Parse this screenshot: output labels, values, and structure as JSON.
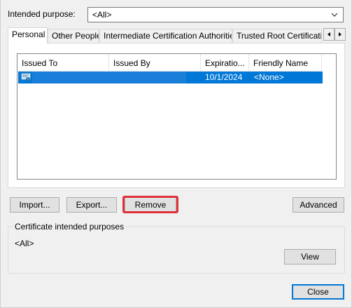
{
  "purpose": {
    "label": "Intended purpose:",
    "selected": "<All>"
  },
  "tabs": [
    {
      "label": "Personal",
      "active": true
    },
    {
      "label": "Other People",
      "active": false
    },
    {
      "label": "Intermediate Certification Authorities",
      "active": false
    },
    {
      "label": "Trusted Root Certification",
      "active": false
    }
  ],
  "list": {
    "columns": [
      "Issued To",
      "Issued By",
      "Expiratio...",
      "Friendly Name"
    ],
    "rows": [
      {
        "issued_to": "",
        "issued_by": "",
        "expiration": "10/1/2024",
        "friendly_name": "<None>",
        "selected": true
      }
    ]
  },
  "buttons": {
    "import": "Import...",
    "export": "Export...",
    "remove": "Remove",
    "advanced": "Advanced",
    "view": "View",
    "close": "Close"
  },
  "purposes_group": {
    "title": "Certificate intended purposes",
    "value": "<All>"
  },
  "colors": {
    "selection": "#0078d7",
    "highlight_box": "#e0303a"
  },
  "icons": {
    "dropdown": "chevron-down-icon",
    "tab_left": "arrow-left-icon",
    "tab_right": "arrow-right-icon",
    "cert": "certificate-icon"
  }
}
